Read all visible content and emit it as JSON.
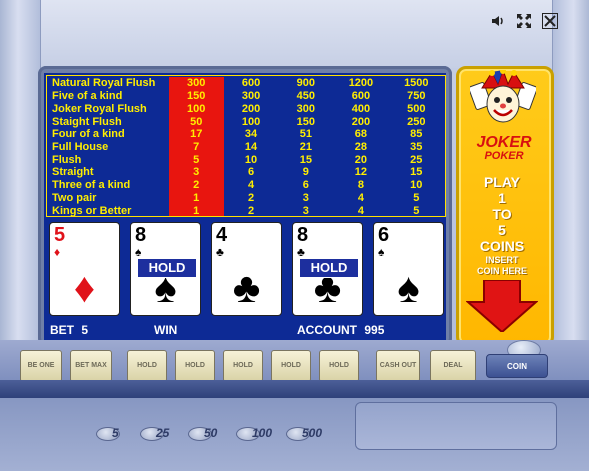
{
  "topbar": {
    "icons": [
      "speaker-icon",
      "fullscreen-icon",
      "close-icon"
    ]
  },
  "paytable": [
    {
      "hand": "Natural Royal Flush",
      "values": [
        "300",
        "600",
        "900",
        "1200",
        "1500"
      ]
    },
    {
      "hand": "Five of a kind",
      "values": [
        "150",
        "300",
        "450",
        "600",
        "750"
      ]
    },
    {
      "hand": "Joker Royal Flush",
      "values": [
        "100",
        "200",
        "300",
        "400",
        "500"
      ]
    },
    {
      "hand": "Staight Flush",
      "values": [
        "50",
        "100",
        "150",
        "200",
        "250"
      ]
    },
    {
      "hand": "Four of a kind",
      "values": [
        "17",
        "34",
        "51",
        "68",
        "85"
      ]
    },
    {
      "hand": "Full House",
      "values": [
        "7",
        "14",
        "21",
        "28",
        "35"
      ]
    },
    {
      "hand": "Flush",
      "values": [
        "5",
        "10",
        "15",
        "20",
        "25"
      ]
    },
    {
      "hand": "Straight",
      "values": [
        "3",
        "6",
        "9",
        "12",
        "15"
      ]
    },
    {
      "hand": "Three of a kind",
      "values": [
        "2",
        "4",
        "6",
        "8",
        "10"
      ]
    },
    {
      "hand": "Two pair",
      "values": [
        "1",
        "2",
        "3",
        "4",
        "5"
      ]
    },
    {
      "hand": "Kings or Better",
      "values": [
        "1",
        "2",
        "3",
        "4",
        "5"
      ]
    }
  ],
  "cards": [
    {
      "rank": "5",
      "suit": "♦",
      "color": "red",
      "held": false
    },
    {
      "rank": "8",
      "suit": "♠",
      "color": "black",
      "held": true
    },
    {
      "rank": "4",
      "suit": "♣",
      "color": "black",
      "held": false
    },
    {
      "rank": "8",
      "suit": "♣",
      "color": "black",
      "held": true
    },
    {
      "rank": "6",
      "suit": "♠",
      "color": "black",
      "held": false
    }
  ],
  "hold_label": "HOLD",
  "status": {
    "bet_label": "BET",
    "bet_value": "5",
    "win_label": "WIN",
    "account_label": "ACCOUNT",
    "account_value": "995"
  },
  "side_panel": {
    "title": "JOKER",
    "subtitle": "POKER",
    "play_lines": [
      "PLAY",
      "1",
      "TO",
      "5",
      "COINS"
    ],
    "insert_lines": [
      "INSERT",
      "COIN HERE"
    ],
    "coin_button": "COIN"
  },
  "buttons": {
    "bet_one": "BE ONE",
    "bet_max": "BET MAX",
    "hold": "HOLD",
    "cash_out": "CASH OUT",
    "deal": "DEAL"
  },
  "coin_denominations": [
    "5",
    "25",
    "50",
    "100",
    "500"
  ],
  "colors": {
    "screen_bg": "#0d2a95",
    "paytable_text": "#ffee00",
    "highlight_column": "#e8150f",
    "panel_yellow": "#ffb700"
  }
}
